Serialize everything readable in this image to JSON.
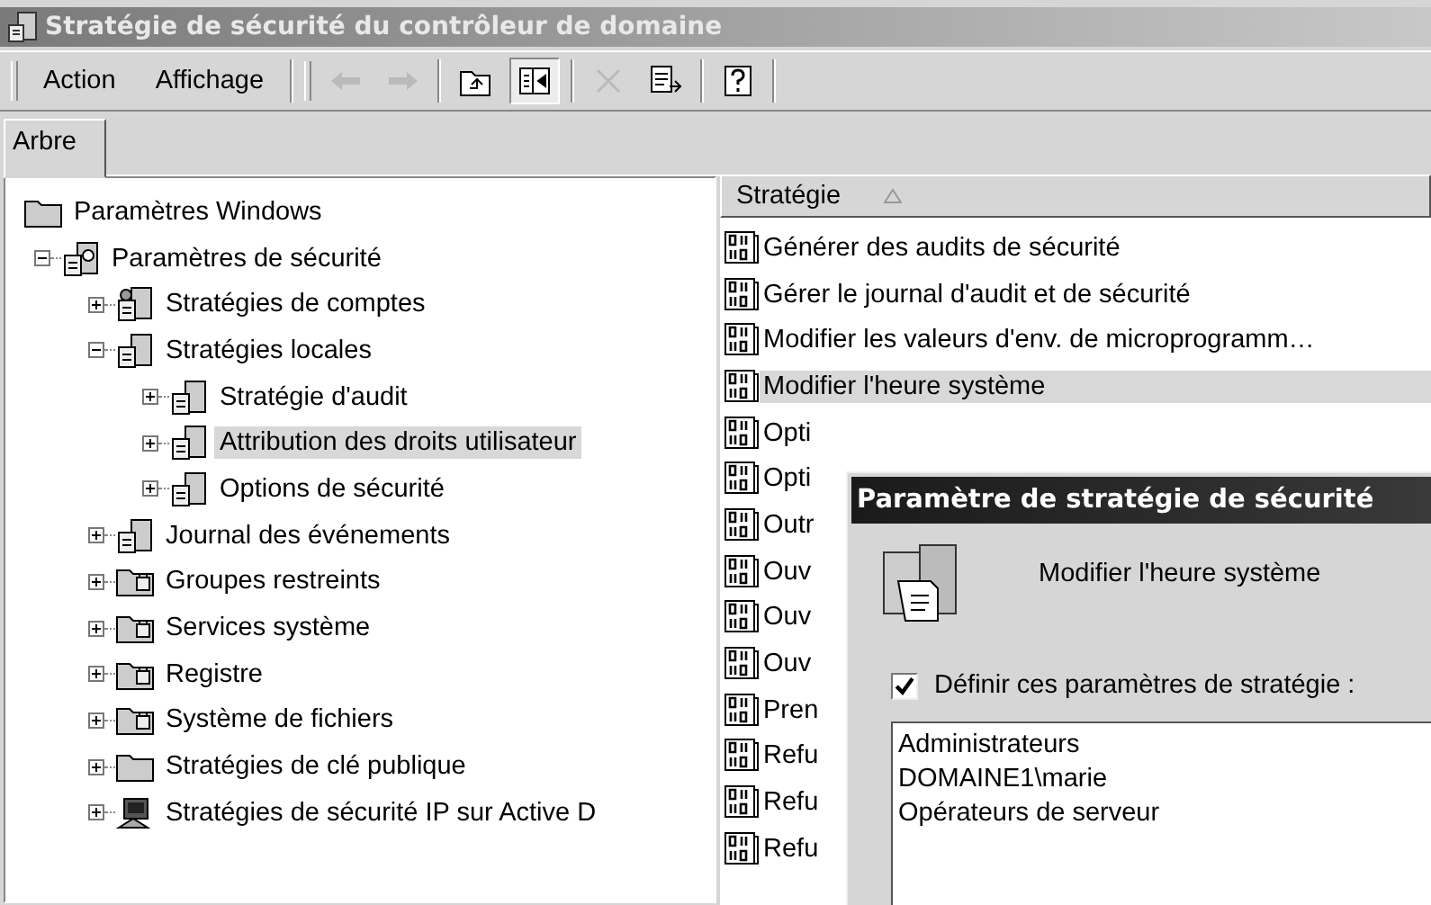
{
  "window": {
    "title": "Stratégie de sécurité du contrôleur de domaine"
  },
  "menu": [
    {
      "label": "Action"
    },
    {
      "label": "Affichage"
    }
  ],
  "toolbar": [
    {
      "kind": "back",
      "disabled": true
    },
    {
      "kind": "forward",
      "disabled": true
    },
    {
      "kind": "up",
      "disabled": false
    },
    {
      "kind": "tree",
      "disabled": false,
      "pressed": true
    },
    {
      "kind": "delete",
      "disabled": true
    },
    {
      "kind": "export",
      "disabled": false
    },
    {
      "kind": "help",
      "disabled": false
    }
  ],
  "tabs": [
    {
      "label": "Arbre",
      "selected": true
    }
  ],
  "tree": [
    {
      "label": "Paramètres Windows",
      "kind": "folder",
      "selected": false,
      "children": [
        {
          "label": "Paramètres de sécurité",
          "kind": "security",
          "expanded": true,
          "selected": false,
          "children": [
            {
              "label": "Stratégies de comptes",
              "kind": "users",
              "expanded": false,
              "selected": false
            },
            {
              "label": "Stratégies locales",
              "kind": "policy",
              "expanded": true,
              "selected": false,
              "children": [
                {
                  "label": "Stratégie d'audit",
                  "kind": "policy",
                  "expanded": false,
                  "selected": false
                },
                {
                  "label": "Attribution des droits utilisateur",
                  "kind": "policy",
                  "expanded": false,
                  "selected": true
                },
                {
                  "label": "Options de sécurité",
                  "kind": "policy",
                  "expanded": false,
                  "selected": false
                }
              ]
            },
            {
              "label": "Journal des événements",
              "kind": "policy",
              "expanded": false,
              "selected": false
            },
            {
              "label": "Groupes restreints",
              "kind": "lockfolder",
              "expanded": false,
              "selected": false
            },
            {
              "label": "Services système",
              "kind": "lockfolder",
              "expanded": false,
              "selected": false
            },
            {
              "label": "Registre",
              "kind": "lockfolder",
              "expanded": false,
              "selected": false
            },
            {
              "label": "Système de fichiers",
              "kind": "lockfolder",
              "expanded": false,
              "selected": false
            },
            {
              "label": "Stratégies de clé publique",
              "kind": "folder",
              "expanded": false,
              "selected": false
            },
            {
              "label": "Stratégies de sécurité IP sur Active D",
              "kind": "network",
              "expanded": false,
              "selected": false
            }
          ]
        }
      ]
    }
  ],
  "list": {
    "column": "Stratégie",
    "items": [
      {
        "label": "Générer des audits de sécurité",
        "selected": false
      },
      {
        "label": "Gérer le journal d'audit et de sécurité",
        "selected": false
      },
      {
        "label": "Modifier les valeurs d'env. de microprogramm…",
        "selected": false
      },
      {
        "label": "Modifier l'heure système",
        "selected": true
      },
      {
        "label": "Opti",
        "selected": false
      },
      {
        "label": "Opti",
        "selected": false
      },
      {
        "label": "Outr",
        "selected": false
      },
      {
        "label": "Ouv",
        "selected": false
      },
      {
        "label": "Ouv",
        "selected": false
      },
      {
        "label": "Ouv",
        "selected": false
      },
      {
        "label": "Pren",
        "selected": false
      },
      {
        "label": "Refu",
        "selected": false
      },
      {
        "label": "Refu",
        "selected": false
      },
      {
        "label": "Refu",
        "selected": false
      }
    ]
  },
  "dialog": {
    "title": "Paramètre de stratégie de sécurité",
    "policy": "Modifier l'heure système",
    "define": {
      "label": "Définir ces paramètres de stratégie :",
      "checked": true
    },
    "accounts": [
      "Administrateurs",
      "DOMAINE1\\marie",
      "Opérateurs de serveur"
    ]
  }
}
